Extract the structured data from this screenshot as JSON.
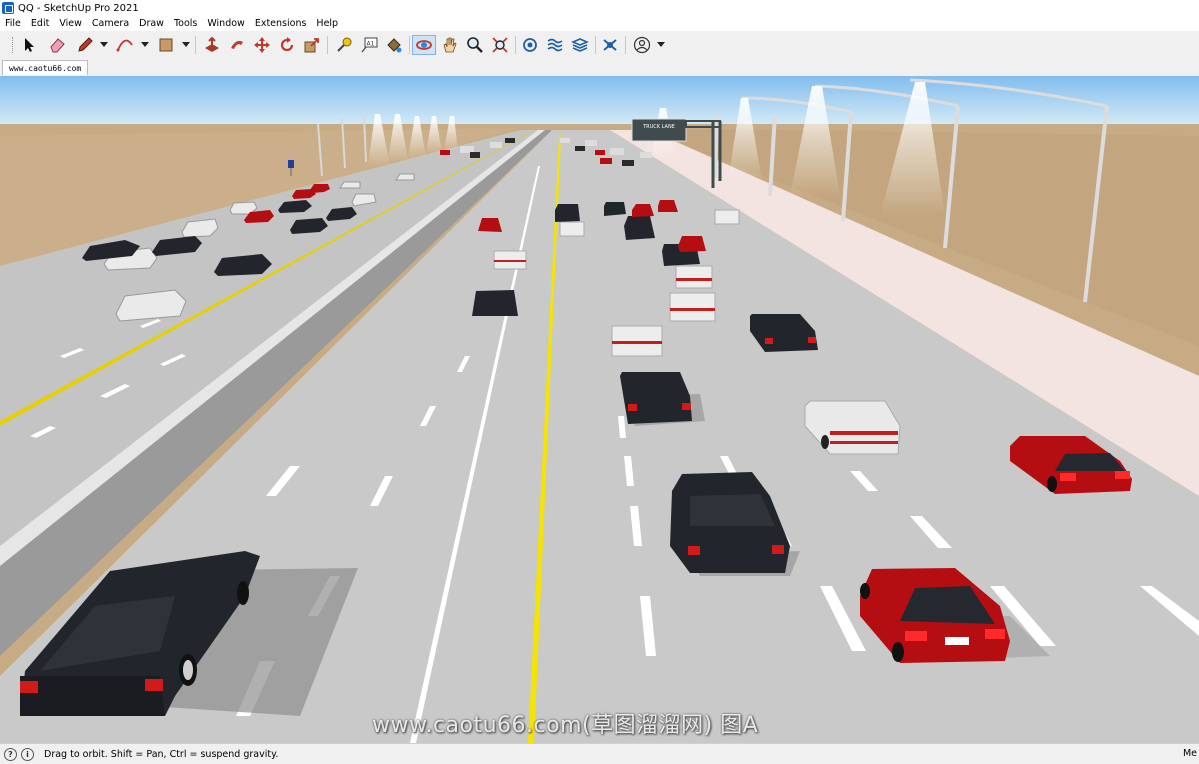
{
  "window": {
    "title": "QQ - SketchUp Pro 2021"
  },
  "menu": [
    "File",
    "Edit",
    "View",
    "Camera",
    "Draw",
    "Tools",
    "Window",
    "Extensions",
    "Help"
  ],
  "toolbar": {
    "tools": [
      {
        "name": "select-tool",
        "icon": "arrow-cursor-icon"
      },
      {
        "name": "eraser-tool",
        "icon": "eraser-icon"
      },
      {
        "name": "line-tool",
        "icon": "pencil-icon",
        "dropdown": true
      },
      {
        "name": "arc-tool",
        "icon": "arc-icon",
        "dropdown": true
      },
      {
        "name": "shapes-tool",
        "icon": "rectangle-icon",
        "dropdown": true
      },
      {
        "name": "push-pull-tool",
        "icon": "push-pull-icon"
      },
      {
        "name": "follow-me-tool",
        "icon": "follow-me-icon"
      },
      {
        "name": "move-tool",
        "icon": "move-icon"
      },
      {
        "name": "rotate-tool",
        "icon": "rotate-icon"
      },
      {
        "name": "scale-tool",
        "icon": "scale-icon"
      },
      {
        "name": "tape-measure-tool",
        "icon": "tape-measure-icon"
      },
      {
        "name": "text-tool",
        "icon": "text-icon"
      },
      {
        "name": "paint-bucket-tool",
        "icon": "paint-bucket-icon"
      },
      {
        "name": "orbit-tool",
        "icon": "orbit-icon",
        "active": true
      },
      {
        "name": "pan-tool",
        "icon": "hand-icon"
      },
      {
        "name": "zoom-tool",
        "icon": "magnifier-icon"
      },
      {
        "name": "zoom-extents-tool",
        "icon": "zoom-extents-icon"
      },
      {
        "name": "warehouse-tool",
        "icon": "warehouse-icon"
      },
      {
        "name": "extension-warehouse-tool",
        "icon": "extension-icon"
      },
      {
        "name": "layout-tool",
        "icon": "layout-icon"
      },
      {
        "name": "extension-manager-tool",
        "icon": "extension-manager-icon"
      },
      {
        "name": "profile-tool",
        "icon": "user-icon",
        "dropdown": true
      }
    ]
  },
  "scene_tab": {
    "label": "www.caotu66.com"
  },
  "watermark": "www.caotu66.com(草图溜溜网) 图A",
  "sign": {
    "line1": "TRUCK LANE"
  },
  "status": {
    "hint": "Drag to orbit. Shift = Pan, Ctrl = suspend gravity.",
    "measurements_label": "Me"
  },
  "colors": {
    "sky": "#9bc9ef",
    "desert": "#c8ad86",
    "road": "#c6c6c6",
    "yellow_line": "#f5e300",
    "car_black": "#23252c",
    "car_red": "#b50e12",
    "car_white": "#e9e9e9"
  }
}
